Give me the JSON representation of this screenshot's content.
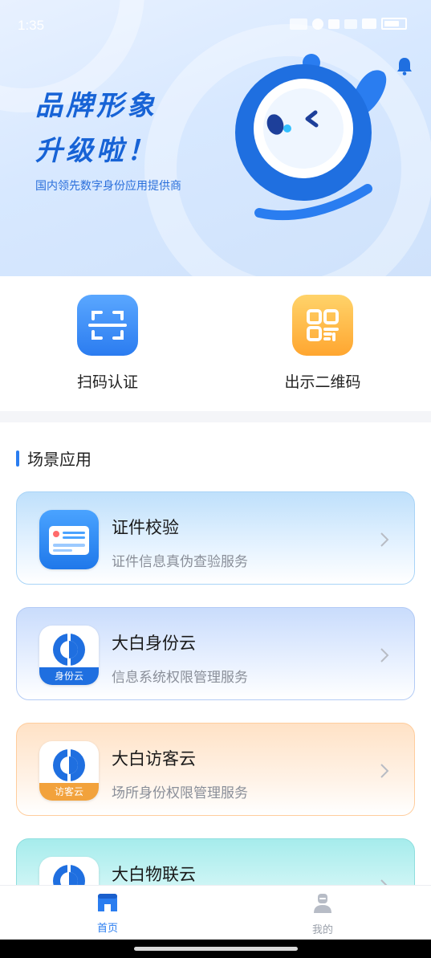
{
  "status_bar": {
    "time": "1:35"
  },
  "hero": {
    "title_line1": "品牌形象",
    "title_line2": "升级啦！",
    "subtitle": "国内领先数字身份应用提供商"
  },
  "actions": [
    {
      "label": "扫码认证",
      "icon": "scan-icon"
    },
    {
      "label": "出示二维码",
      "icon": "qr-code-icon"
    }
  ],
  "section": {
    "title": "场景应用"
  },
  "cards": [
    {
      "title": "证件校验",
      "desc": "证件信息真伪查验服务",
      "icon": "id-card-icon"
    },
    {
      "title": "大白身份云",
      "desc": "信息系统权限管理服务",
      "icon": "identity-cloud-icon",
      "tag": "身份云"
    },
    {
      "title": "大白访客云",
      "desc": "场所身份权限管理服务",
      "icon": "visitor-cloud-icon",
      "tag": "访客云"
    },
    {
      "title": "大白物联云",
      "desc": "",
      "icon": "iot-cloud-icon"
    }
  ],
  "bottom_nav": [
    {
      "label": "首页",
      "icon": "home-icon",
      "active": true
    },
    {
      "label": "我的",
      "icon": "profile-icon",
      "active": false
    }
  ],
  "colors": {
    "accent": "#2a7df0",
    "brand_blue": "#1763d6",
    "orange": "#ffa630"
  }
}
